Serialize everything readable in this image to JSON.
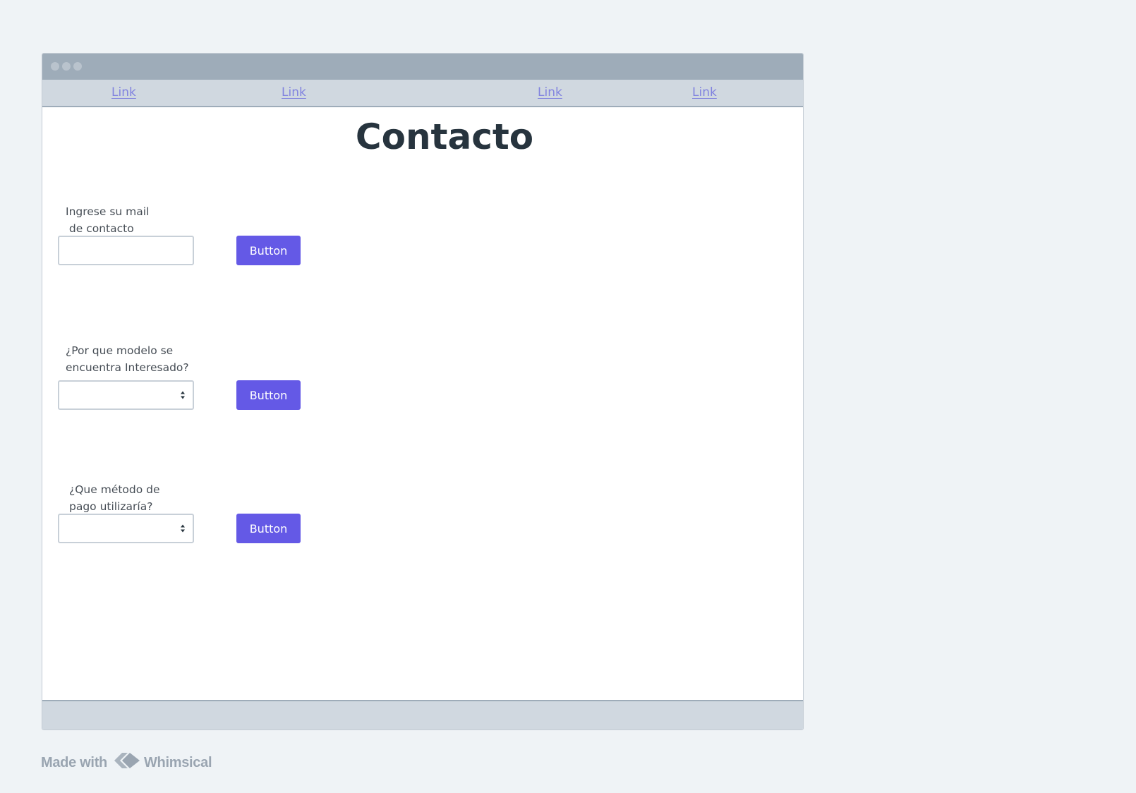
{
  "nav": {
    "links": [
      "Link",
      "Link",
      "Link",
      "Link"
    ]
  },
  "page": {
    "title": "Contacto"
  },
  "form": {
    "email": {
      "label": "Ingrese su mail\n de contacto",
      "value": "",
      "button_label": "Button"
    },
    "model": {
      "label": "¿Por que modelo se\nencuentra Interesado?",
      "selected": "",
      "button_label": "Button"
    },
    "payment": {
      "label": "¿Que método de\npago utilizaría?",
      "selected": "",
      "button_label": "Button"
    }
  },
  "watermark": {
    "made_with": "Made with",
    "brand": "Whimsical"
  },
  "colors": {
    "accent": "#6459e6",
    "link": "#8183df",
    "title": "#27343e",
    "chrome": "#9eacb9",
    "navbar": "#d0d8e0",
    "background": "#eff3f6"
  },
  "icons": {
    "window_controls": "window-dots-icon",
    "select_arrow": "select-arrows-icon",
    "brand_logo": "whimsical-logo-icon"
  }
}
